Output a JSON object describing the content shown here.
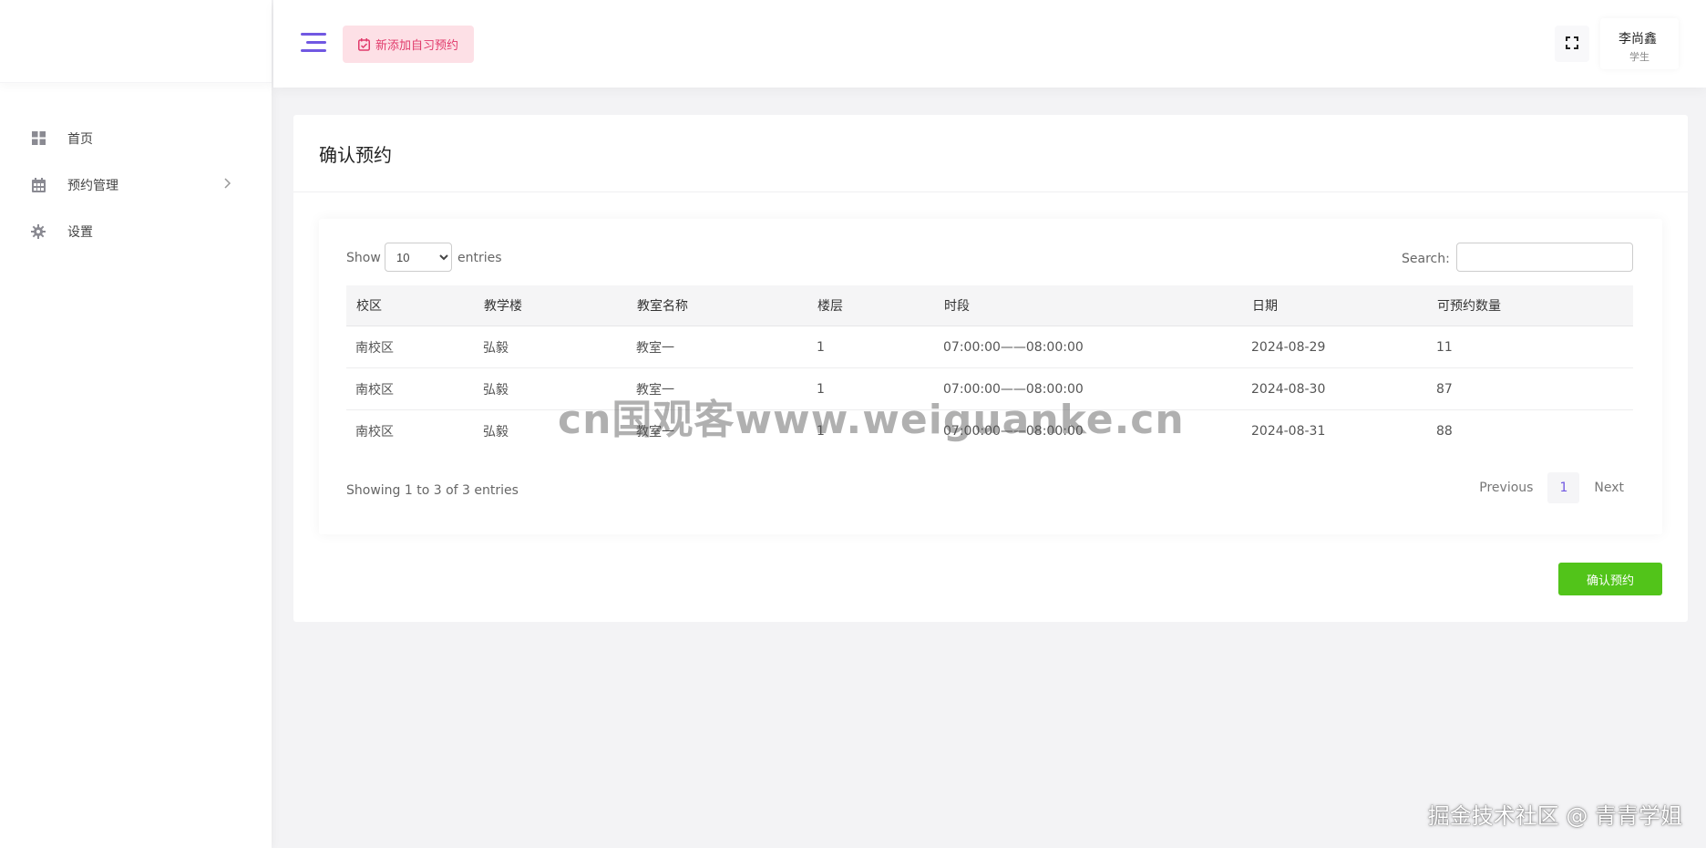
{
  "sidebar": {
    "items": [
      {
        "label": "首页",
        "icon": "dashboard-icon"
      },
      {
        "label": "预约管理",
        "icon": "calendar-icon"
      },
      {
        "label": "设置",
        "icon": "gear-icon"
      }
    ]
  },
  "header": {
    "add_button": "新添加自习预约",
    "user_name": "李尚鑫",
    "user_role": "学生"
  },
  "card": {
    "title": "确认预约",
    "confirm_button": "确认预约"
  },
  "datatable": {
    "show_label": "Show",
    "entries_label": "entries",
    "page_length": "10",
    "page_length_options": [
      "10"
    ],
    "search_label": "Search:",
    "search_value": "",
    "columns": [
      "校区",
      "教学楼",
      "教室名称",
      "楼层",
      "时段",
      "日期",
      "可预约数量"
    ],
    "rows": [
      [
        "南校区",
        "弘毅",
        "教室一",
        "1",
        "07:00:00——08:00:00",
        "2024-08-29",
        "11"
      ],
      [
        "南校区",
        "弘毅",
        "教室一",
        "1",
        "07:00:00——08:00:00",
        "2024-08-30",
        "87"
      ],
      [
        "南校区",
        "弘毅",
        "教室一",
        "1",
        "07:00:00——08:00:00",
        "2024-08-31",
        "88"
      ]
    ],
    "info": "Showing 1 to 3 of 3 entries",
    "pagination": {
      "previous": "Previous",
      "current": "1",
      "next": "Next"
    }
  },
  "watermarks": {
    "center": "cn国观客www.weiguanke.cn",
    "corner": "掘金技术社区 @ 青青学姐"
  },
  "colors": {
    "accent": "#7158e2",
    "add_button_bg": "#fde0e6",
    "add_button_text": "#e13a6b",
    "confirm_button": "#52c41a"
  }
}
